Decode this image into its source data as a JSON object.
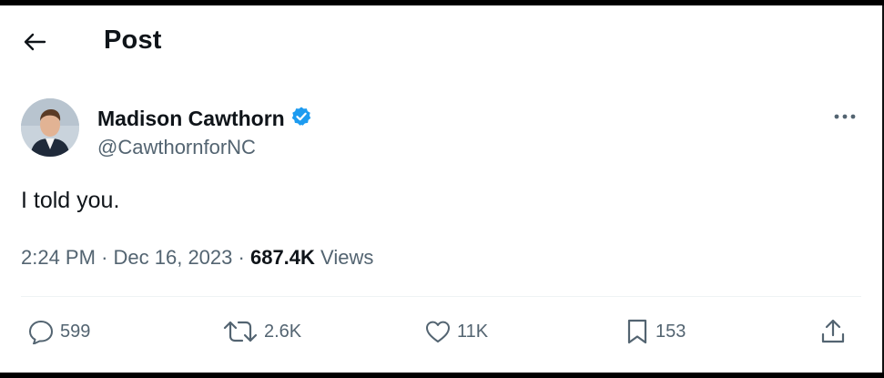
{
  "header": {
    "title": "Post",
    "back_icon": "arrow-left-icon"
  },
  "author": {
    "name": "Madison Cawthorn",
    "handle": "@CawthornforNC",
    "verified_icon": "verified-badge-icon",
    "verified_color": "#1d9bf0"
  },
  "post": {
    "text": "I told you."
  },
  "meta": {
    "time": "2:24 PM",
    "separator_1": "·",
    "date": "Dec 16, 2023",
    "separator_2": "·",
    "views_count": "687.4K",
    "views_label": "Views"
  },
  "actions": {
    "replies": "599",
    "reposts": "2.6K",
    "likes": "11K",
    "bookmarks": "153"
  },
  "icons": {
    "more": "more-horizontal-icon",
    "reply": "reply-icon",
    "repost": "repost-icon",
    "like": "heart-icon",
    "bookmark": "bookmark-icon",
    "share": "share-icon"
  },
  "colors": {
    "text_primary": "#0f1419",
    "text_secondary": "#536471",
    "divider": "#eff3f4"
  }
}
